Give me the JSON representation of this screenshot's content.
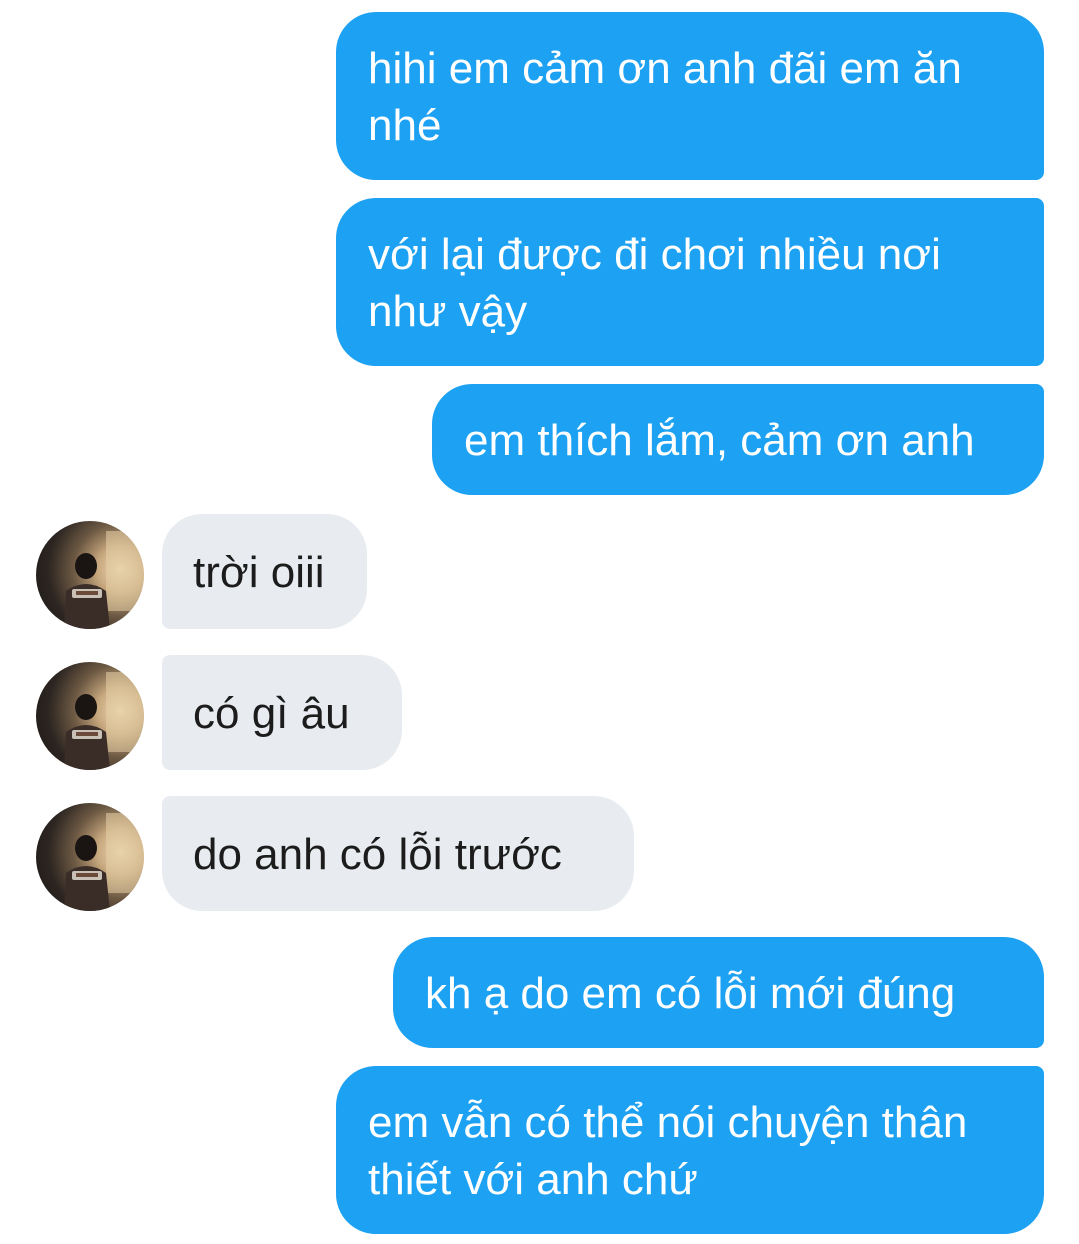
{
  "messages": [
    {
      "id": "b1",
      "direction": "sent",
      "text": "hihi em cảm ơn anh đãi em ăn nhé"
    },
    {
      "id": "b2",
      "direction": "sent",
      "text": "với lại được đi chơi nhiều nơi như vậy"
    },
    {
      "id": "b3",
      "direction": "sent",
      "text": "em thích lắm, cảm ơn anh"
    },
    {
      "id": "r1",
      "direction": "received",
      "text": "trời oiii"
    },
    {
      "id": "r2",
      "direction": "received",
      "text": "có gì âu"
    },
    {
      "id": "r3",
      "direction": "received",
      "text": "do anh có lỗi trước"
    },
    {
      "id": "b4",
      "direction": "sent",
      "text": "kh ạ do em có lỗi mới đúng"
    },
    {
      "id": "b5",
      "direction": "sent",
      "text": "em vẫn có thể nói chuyện thân thiết với anh chứ"
    }
  ],
  "colors": {
    "sent_bubble": "#1da1f2",
    "sent_text": "#ffffff",
    "received_bubble": "#e8ecf0",
    "received_text": "#1c1c1c",
    "background": "#ffffff"
  }
}
